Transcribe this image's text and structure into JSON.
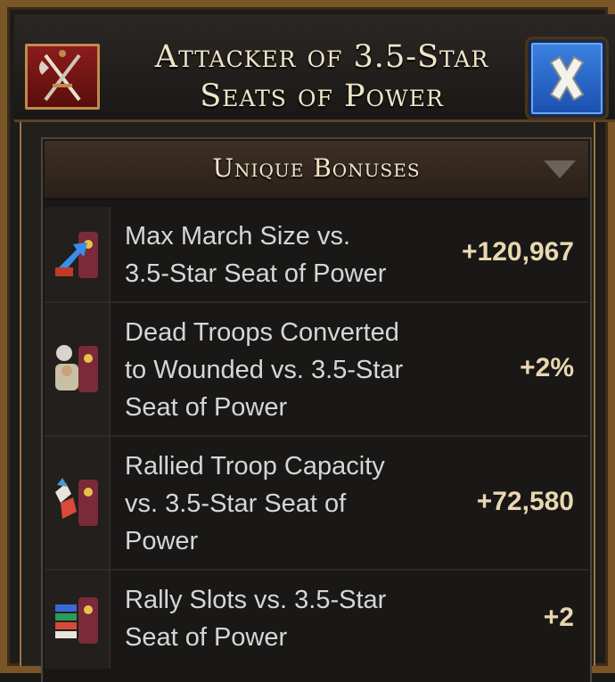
{
  "window": {
    "title_line1": "Attacker of 3.5-Star",
    "title_line2": "Seats of Power",
    "icon": "crossed-sword-axe-banner-icon",
    "close_icon": "close-x-icon"
  },
  "section": {
    "title": "Unique Bonuses",
    "toggle_icon": "chevron-down-icon"
  },
  "bonuses": [
    {
      "label_lines": [
        "Max March Size vs.",
        "3.5-Star Seat of Power"
      ],
      "value": "+120,967",
      "icon": "march-size-throne-icon"
    },
    {
      "label_lines": [
        "Dead Troops Converted",
        "to Wounded vs. 3.5-Star",
        "Seat of Power"
      ],
      "value": "+2%",
      "icon": "healer-throne-icon"
    },
    {
      "label_lines": [
        "Rallied Troop Capacity",
        "vs. 3.5-Star Seat of",
        "Power"
      ],
      "value": "+72,580",
      "icon": "rally-capacity-throne-icon"
    },
    {
      "label_lines": [
        "Rally Slots vs. 3.5-Star",
        "Seat of Power"
      ],
      "value": "+2",
      "icon": "rally-slots-throne-icon"
    }
  ],
  "colors": {
    "frame": "#7a5526",
    "title_text": "#efe6c8",
    "label_text": "#d6d6d6",
    "value_text": "#e9d7b0",
    "close_button": "#2a66c8",
    "banner": "#8b1c1c"
  }
}
